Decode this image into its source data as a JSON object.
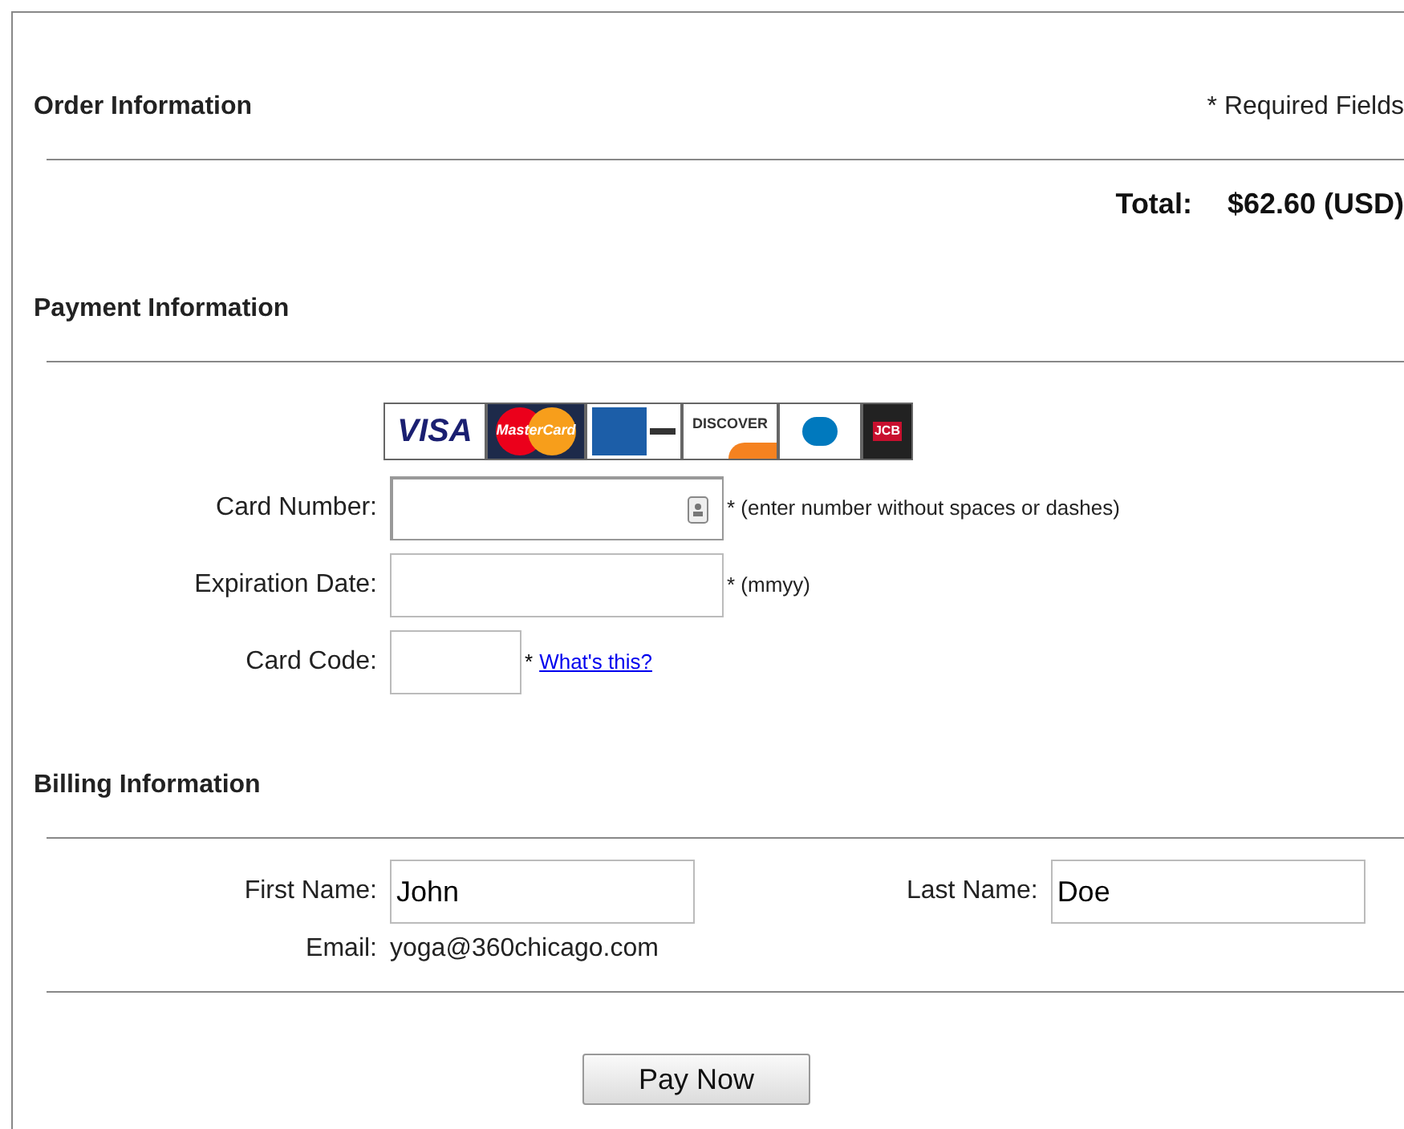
{
  "order": {
    "heading": "Order Information",
    "required_note": "* Required Fields",
    "total_label": "Total:",
    "total_value": "$62.60 (USD)"
  },
  "payment": {
    "heading": "Payment Information",
    "card_logos": [
      {
        "kind": "visa",
        "label": "VISA"
      },
      {
        "kind": "mastercard",
        "label": "MasterCard"
      },
      {
        "kind": "amex"
      },
      {
        "kind": "discover",
        "label": "DISCOVER"
      },
      {
        "kind": "diners"
      },
      {
        "kind": "jcb",
        "label": "JCB"
      }
    ],
    "fields": [
      {
        "label": "Card Number:",
        "kind": "card",
        "hint": "* (enter number without spaces or dashes)"
      },
      {
        "label": "Expiration Date:",
        "kind": "wide",
        "hint": "* (mmyy)"
      },
      {
        "label": "Card Code:",
        "kind": "short",
        "asterisk": "*",
        "link": "What's this?"
      }
    ]
  },
  "billing": {
    "heading": "Billing Information",
    "first_name": {
      "label": "First Name:",
      "value": "John"
    },
    "last_name": {
      "label": "Last Name:",
      "value": "Doe"
    },
    "email": {
      "label": "Email:",
      "value": "yoga@360chicago.com"
    }
  },
  "button": "Pay Now"
}
